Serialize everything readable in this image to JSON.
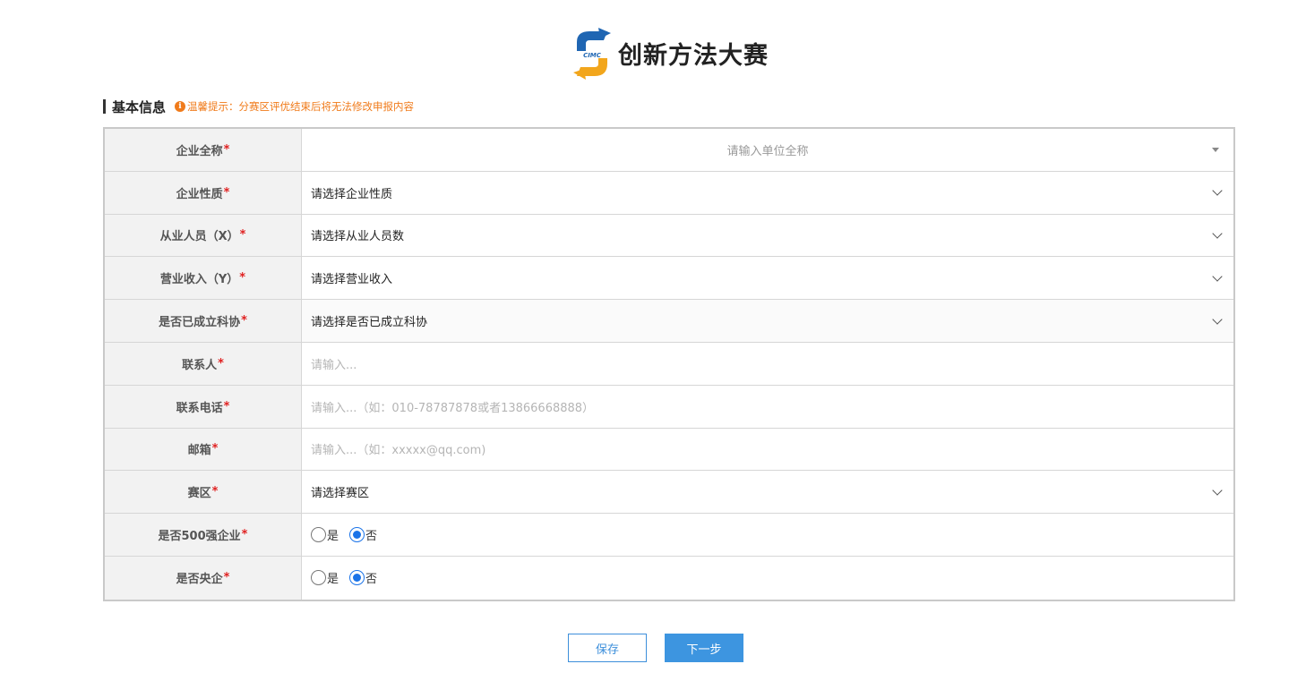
{
  "header": {
    "title": "创新方法大赛",
    "logo_text": "CIMC"
  },
  "section": {
    "title": "基本信息",
    "tip_icon": "info-icon",
    "tip": "温馨提示：分赛区评优结束后将无法修改申报内容"
  },
  "form": {
    "required_mark": "*",
    "company_name": {
      "label": "企业全称",
      "placeholder": "请输入单位全称"
    },
    "company_type": {
      "label": "企业性质",
      "value": "请选择企业性质"
    },
    "employees": {
      "label": "从业人员（X）",
      "value": "请选择从业人员数"
    },
    "revenue": {
      "label": "营业收入（Y）",
      "value": "请选择营业收入"
    },
    "sci_assoc": {
      "label": "是否已成立科协",
      "value": "请选择是否已成立科协"
    },
    "contact": {
      "label": "联系人",
      "placeholder": "请输入..."
    },
    "phone": {
      "label": "联系电话",
      "placeholder": "请输入...（如：010-78787878或者13866668888）"
    },
    "email": {
      "label": "邮箱",
      "placeholder": "请输入...（如：xxxxx@qq.com)"
    },
    "region": {
      "label": "赛区",
      "value": "请选择赛区"
    },
    "top500": {
      "label": "是否500强企业",
      "yes": "是",
      "no": "否",
      "selected": "否"
    },
    "central": {
      "label": "是否央企",
      "yes": "是",
      "no": "否",
      "selected": "否"
    }
  },
  "buttons": {
    "save": "保存",
    "next": "下一步"
  },
  "colors": {
    "accent": "#3d95e0",
    "tip": "#f07b1b",
    "required": "#e02020"
  }
}
